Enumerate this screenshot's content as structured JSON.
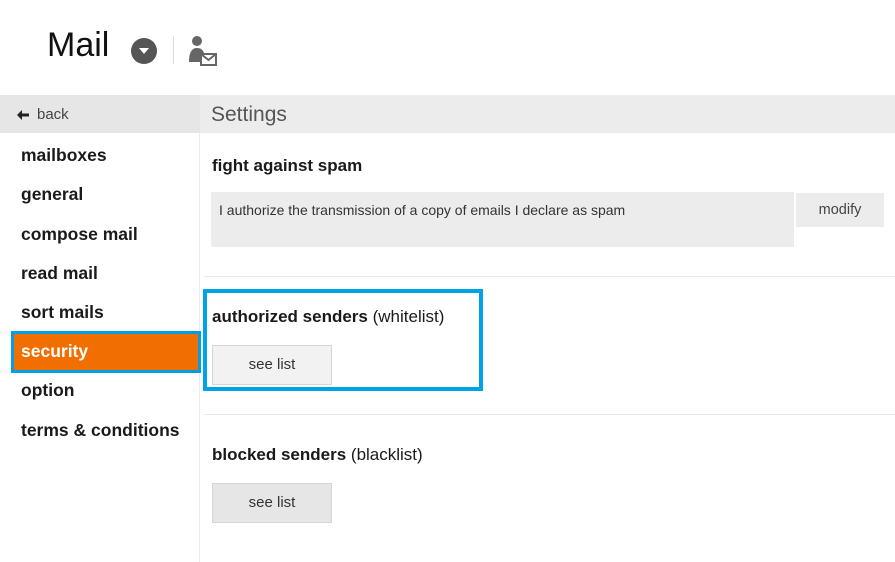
{
  "header": {
    "app_title": "Mail",
    "dropdown_icon": "chevron-down-icon",
    "contact_icon": "user-mail-icon"
  },
  "nav": {
    "back_label": "back",
    "items": [
      {
        "label": "mailboxes",
        "active": false
      },
      {
        "label": "general",
        "active": false
      },
      {
        "label": "compose mail",
        "active": false
      },
      {
        "label": "read mail",
        "active": false
      },
      {
        "label": "sort mails",
        "active": false
      },
      {
        "label": "security",
        "active": true
      },
      {
        "label": "option",
        "active": false
      },
      {
        "label": "terms & conditions",
        "active": false
      }
    ]
  },
  "page": {
    "title": "Settings"
  },
  "spam": {
    "title": "fight against spam",
    "text": "I authorize the transmission of a copy of emails I declare as spam",
    "button": "modify"
  },
  "whitelist": {
    "title": "authorized senders",
    "subtitle": "(whitelist)",
    "button": "see list"
  },
  "blacklist": {
    "title": "blocked senders",
    "subtitle": "(blacklist)",
    "button": "see list"
  },
  "colors": {
    "accent_orange": "#f16e00",
    "highlight_blue": "#00a3e8"
  }
}
